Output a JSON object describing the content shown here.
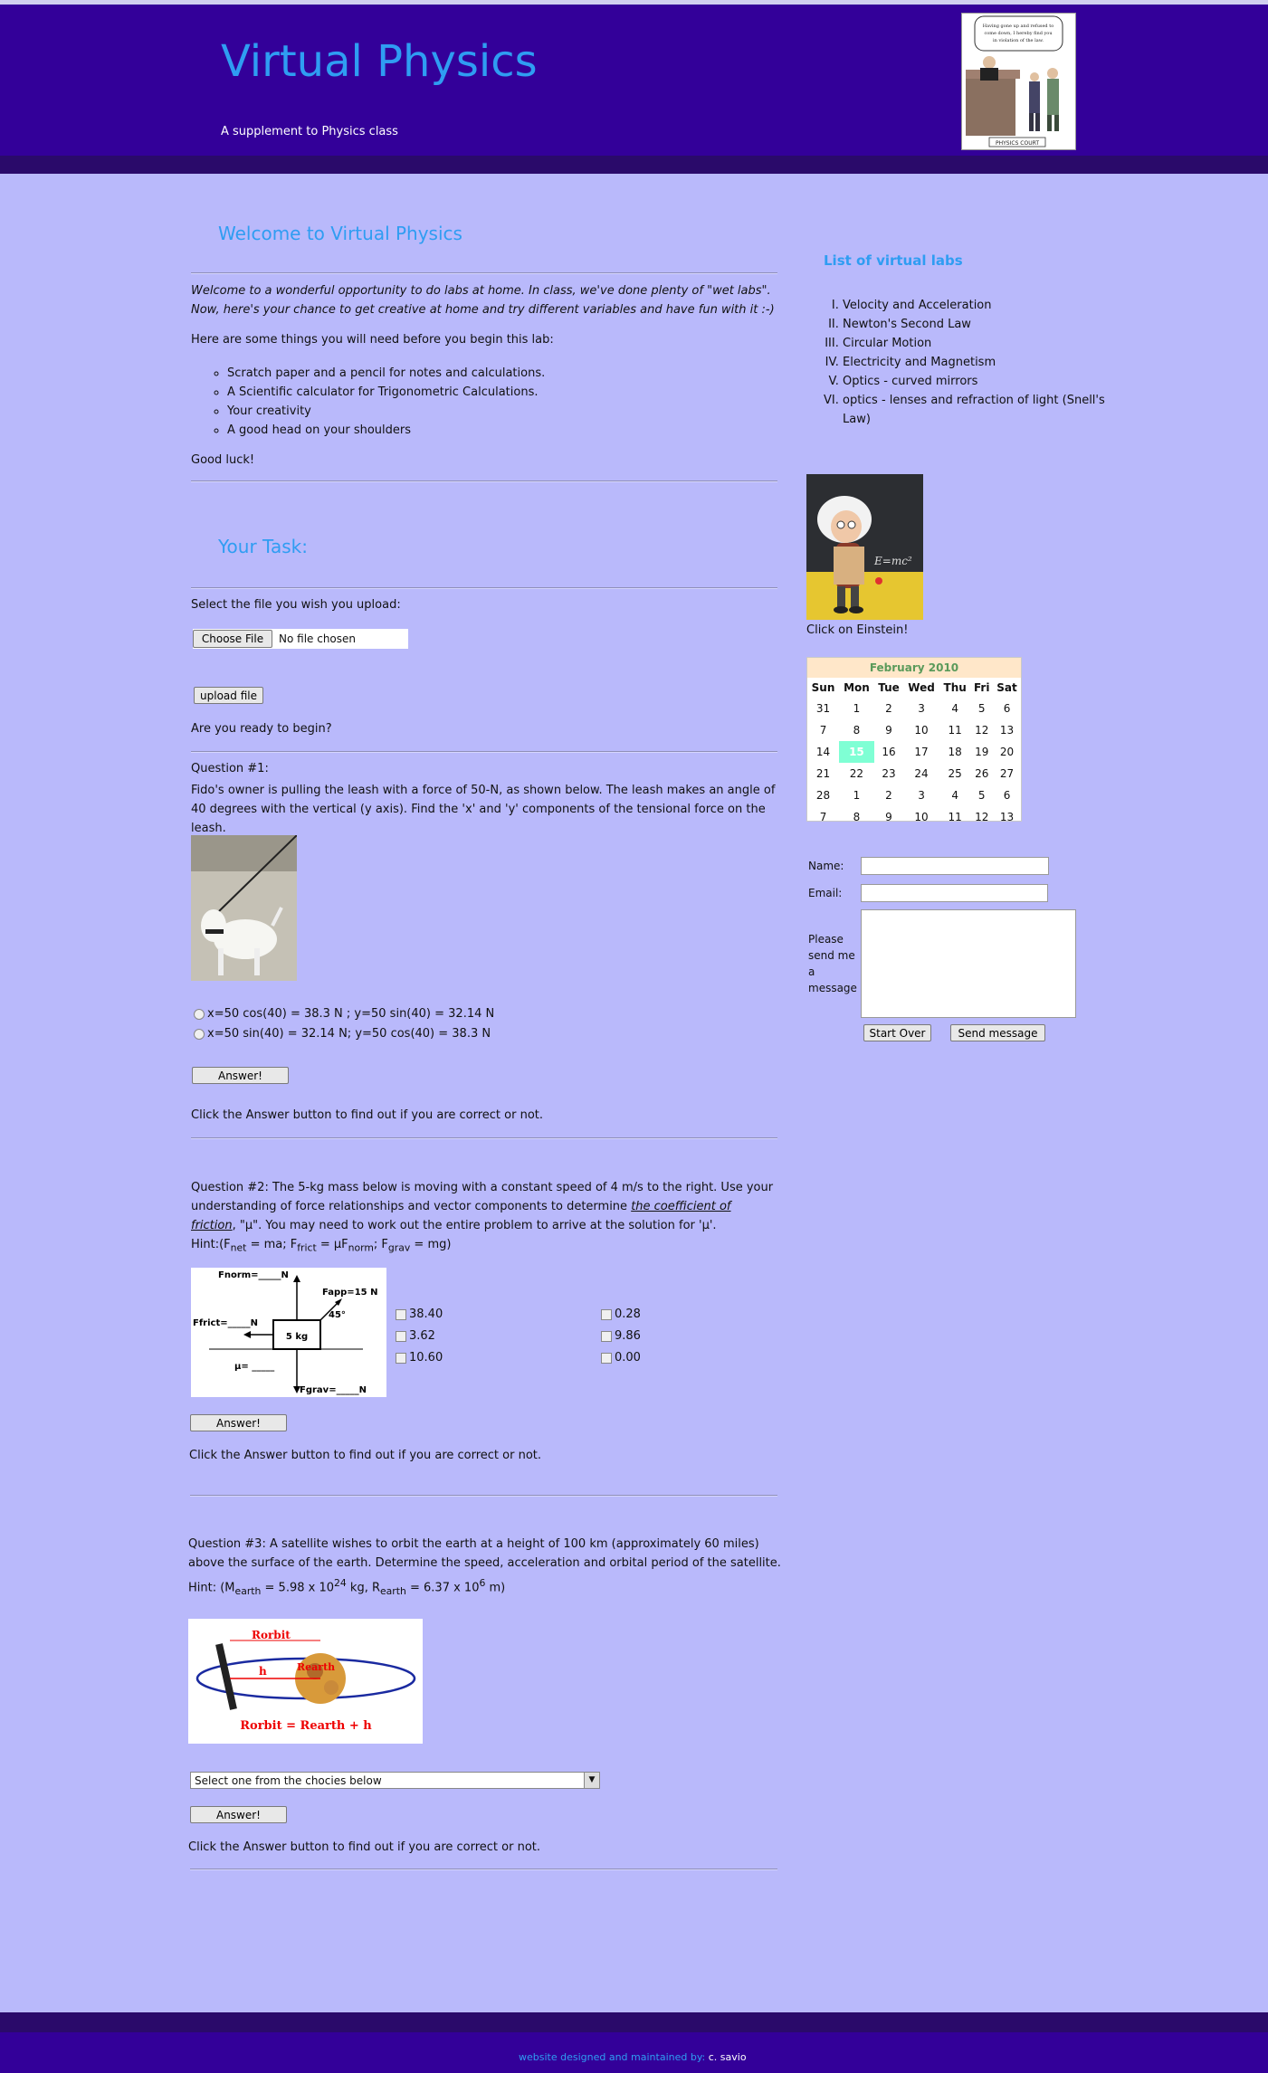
{
  "header": {
    "title": "Virtual Physics",
    "tagline": "A supplement to Physics class",
    "comic_caption": "Having gone up and refused to come down, I hereby find you in violation of the law.",
    "comic_label": "PHYSICS COURT"
  },
  "welcome": {
    "heading": "Welcome to Virtual Physics",
    "intro": "Welcome to a wonderful opportunity to do labs at home. In class, we've done plenty of \"wet labs\". Now, here's your chance to get creative at home and try different variables and have fun with it :-)",
    "needs_intro": "Here are some things you will need before you begin this lab:",
    "items": [
      "Scratch paper and a pencil for notes and calculations.",
      "A Scientific calculator for Trigonometric Calculations.",
      "Your creativity",
      "A good head on your shoulders"
    ],
    "closing": "Good luck!"
  },
  "task": {
    "heading": "Your Task:",
    "select_label": "Select the file you wish you upload:",
    "choose_file": "Choose File",
    "no_file": "No file chosen",
    "upload": "upload file",
    "ready": "Are you ready to begin?"
  },
  "q1": {
    "title": "Question #1:",
    "text": "Fido's owner is pulling the leash with a force of 50-N, as shown below. The leash makes an angle of 40 degrees with the vertical (y axis). Find the 'x' and 'y' components of the tensional force on the leash.",
    "options": [
      "x=50 cos(40) = 38.3 N ; y=50 sin(40) = 32.14 N",
      "x=50 sin(40) = 32.14 N; y=50 cos(40) = 38.3 N"
    ],
    "answer": "Answer!",
    "note": "Click the Answer button to find out if you are correct or not."
  },
  "q2": {
    "text_a": "Question #2: The 5-kg mass below is moving with a constant speed of 4 m/s to the right. Use your understanding of force relationships and vector components to determine ",
    "text_link": "the coefficient of friction",
    "text_b": ", \"μ\". You may need to work out the entire problem to arrive at the solution for 'μ'.",
    "hint_prefix": "Hint:(F",
    "hint_net": "net",
    "hint_mid1": " = ma; F",
    "hint_frict": "frict",
    "hint_mid2": " = μF",
    "hint_norm": "norm",
    "hint_mid3": "; F",
    "hint_grav": "grav",
    "hint_end": " = mg)",
    "diagram": {
      "fnorm": "Fnorm=_____N",
      "fapp": "Fapp=15 N",
      "angle": "45°",
      "ffrict": "Ffrict=_____N",
      "mass": "5 kg",
      "mu": "μ= _____",
      "fgrav": "Fgrav=_____N"
    },
    "options_left": [
      "38.40",
      "3.62",
      "10.60"
    ],
    "options_right": [
      "0.28",
      "9.86",
      "0.00"
    ],
    "answer": "Answer!",
    "note": "Click the Answer button to find out if you are correct or not."
  },
  "q3": {
    "text": "Question #3: A satellite wishes to orbit the earth at a height of 100 km (approximately 60 miles) above the surface of the earth. Determine the speed, acceleration and orbital period of the satellite.",
    "hint_a": "Hint: (M",
    "hint_earth1": "earth",
    "hint_b": " = 5.98 x 10",
    "hint_exp1": "24",
    "hint_c": " kg, R",
    "hint_earth2": "earth",
    "hint_d": " = 6.37 x 10",
    "hint_exp2": "6",
    "hint_e": " m)",
    "diagram": {
      "rorbit": "Rorbit",
      "h": "h",
      "rearth": "Rearth",
      "formula": "Rorbit = Rearth + h"
    },
    "select": "Select one from the chocies below",
    "answer": "Answer!",
    "note": "Click the Answer button to find out if you are correct or not."
  },
  "sidebar": {
    "labs_heading": "List of virtual labs",
    "labs": [
      "Velocity and Acceleration",
      "Newton's Second Law",
      "Circular Motion",
      "Electricity and Magnetism",
      "Optics - curved mirrors",
      "optics - lenses and refraction of light (Snell's Law)"
    ],
    "einstein_caption": "Click on Einstein!",
    "einstein_formula": "E=mc²"
  },
  "calendar": {
    "title": "February 2010",
    "days": [
      "Sun",
      "Mon",
      "Tue",
      "Wed",
      "Thu",
      "Fri",
      "Sat"
    ],
    "weeks": [
      [
        "31",
        "1",
        "2",
        "3",
        "4",
        "5",
        "6"
      ],
      [
        "7",
        "8",
        "9",
        "10",
        "11",
        "12",
        "13"
      ],
      [
        "14",
        "15",
        "16",
        "17",
        "18",
        "19",
        "20"
      ],
      [
        "21",
        "22",
        "23",
        "24",
        "25",
        "26",
        "27"
      ],
      [
        "28",
        "1",
        "2",
        "3",
        "4",
        "5",
        "6"
      ],
      [
        "7",
        "8",
        "9",
        "10",
        "11",
        "12",
        "13"
      ]
    ],
    "today": "15"
  },
  "contact": {
    "name_label": "Name:",
    "email_label": "Email:",
    "message_label": "Please send me a message",
    "start_over": "Start Over",
    "send": "Send message"
  },
  "footer": {
    "text": "website designed and maintained by: ",
    "author": "c. savio"
  },
  "colors": {
    "header": "#330099",
    "background": "#b9b9fb",
    "heading": "#2f9df2"
  }
}
